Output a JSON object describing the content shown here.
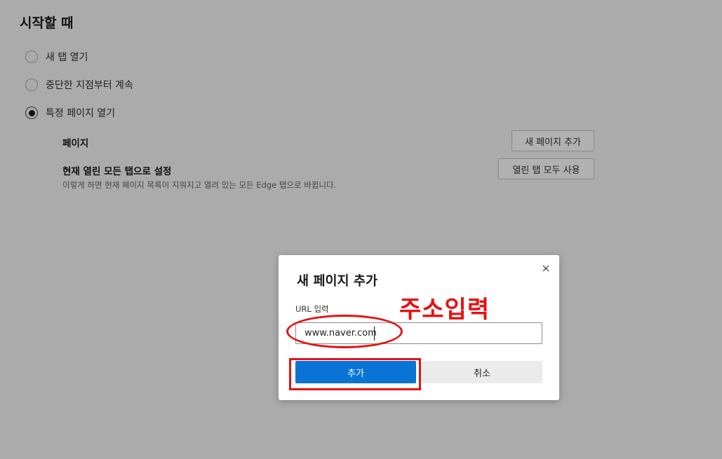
{
  "section": {
    "title": "시작할 때"
  },
  "startup_options": [
    {
      "label": "새 탭 열기",
      "checked": false
    },
    {
      "label": "중단한 지점부터 계속",
      "checked": false
    },
    {
      "label": "특정 페이지 열기",
      "checked": true
    }
  ],
  "pages": {
    "label": "페이지",
    "add_button": "새 페이지 추가"
  },
  "current_tabs": {
    "label": "현재 열린 모든 탭으로 설정",
    "description": "이렇게 하면 현재 페이지 목록이 지워지고 열려 있는 모든 Edge 탭으로 바뀝니다.",
    "use_all_button": "열린 탭 모두 사용"
  },
  "dialog": {
    "title": "새 페이지 추가",
    "field_label": "URL 입력",
    "url_value": "www.naver.com",
    "add_button": "추가",
    "cancel_button": "취소",
    "close_icon": "close-icon"
  },
  "annotation": {
    "text": "주소입력",
    "color": "#e81010"
  },
  "colors": {
    "overlay_background": "#ababab",
    "primary_button": "#0a74d6"
  }
}
